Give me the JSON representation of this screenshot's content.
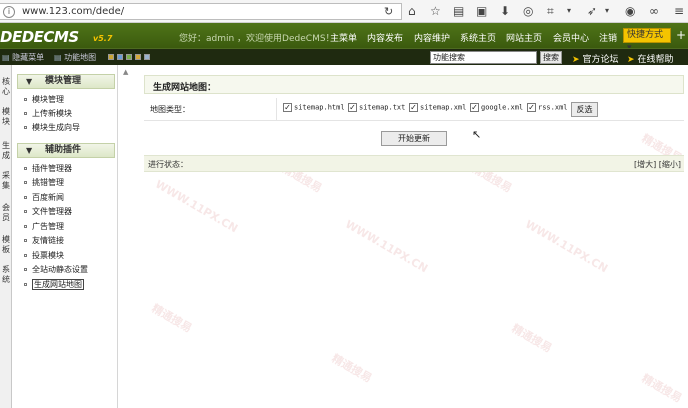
{
  "browser": {
    "url": "www.123.com/dede/",
    "icons": [
      "reload-icon",
      "home-icon",
      "star-icon",
      "bookmark-icon",
      "reader-icon",
      "download-icon",
      "shield-icon",
      "crop-icon",
      "dropdown-icon",
      "arrow-icon",
      "dropdown-icon",
      "globe-icon",
      "glasses-icon"
    ]
  },
  "header": {
    "logo": "DEDECMS",
    "version": "v5.7",
    "welcome": "您好：admin ，欢迎使用DedeCMS！",
    "nav": [
      "主菜单",
      "内容发布",
      "内容维护",
      "系统主页",
      "网站主页",
      "会员中心",
      "注销"
    ],
    "quick_button": "快捷方式",
    "plus": "+"
  },
  "toolbar": {
    "hide_menu": "隐藏菜单",
    "function_map": "功能地图",
    "search_value": "功能搜索",
    "search_button": "搜索",
    "official_forum": "官方论坛",
    "online_help": "在线帮助"
  },
  "vtabs": [
    "核心",
    "模块",
    "生成",
    "采集",
    "会员",
    "模板",
    "系统"
  ],
  "sidebar": {
    "sections": [
      {
        "title": "模块管理",
        "items": [
          "模块管理",
          "上传新模块",
          "模块生成向导"
        ]
      },
      {
        "title": "辅助插件",
        "items": [
          "插件管理器",
          "挑错管理",
          "百度新闻",
          "文件管理器",
          "广告管理",
          "友情链接",
          "投票模块",
          "全站动静态设置",
          "生成网站地图"
        ]
      }
    ]
  },
  "main": {
    "title": "生成网站地图：",
    "map_type_label": "地图类型：",
    "options": [
      {
        "label": "sitemap.html",
        "checked": true
      },
      {
        "label": "sitemap.txt",
        "checked": true
      },
      {
        "label": "sitemap.xml",
        "checked": true
      },
      {
        "label": "google.xml",
        "checked": true
      },
      {
        "label": "rss.xml",
        "checked": true
      }
    ],
    "invert_button": "反选",
    "start_button": "开始更新",
    "progress_label": "进行状态：",
    "zoom_in": "[增大]",
    "zoom_out": "[缩小]"
  },
  "watermark": {
    "cn": "精通搜易",
    "url": "WWW.11PX.CN"
  }
}
